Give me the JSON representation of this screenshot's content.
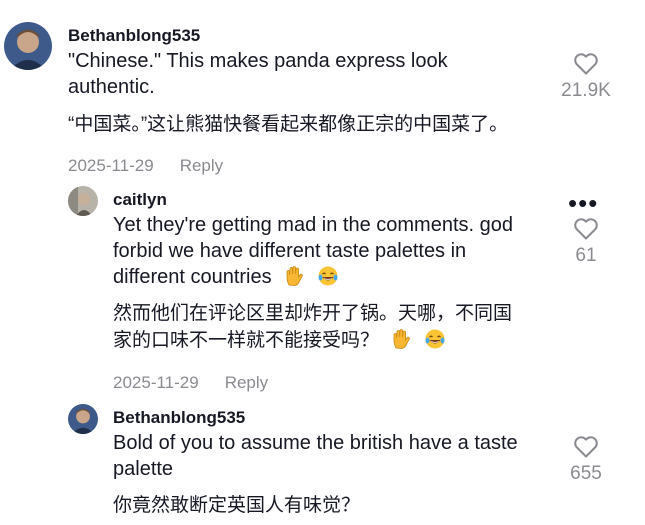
{
  "comments": [
    {
      "username": "Bethanblong535",
      "text_line1": "\"Chinese.\" This makes panda express look",
      "text_line2": "authentic.",
      "translation": "“中国菜。”这让熊猫快餐看起来都像正宗的中国菜了。",
      "date": "2025-11-29",
      "reply_label": "Reply",
      "likes": "21.9K"
    },
    {
      "username": "caitlyn",
      "text_line1": "Yet they're getting mad in the comments. god",
      "text_line2": "forbid we have different taste palettes in",
      "text_line3": "different countries",
      "translation_line1": "然而他们在评论区里却炸开了锅。天哪，不同国",
      "translation_line2": "家的口味不一样就不能接受吗？",
      "date": "2025-11-29",
      "reply_label": "Reply",
      "likes": "61",
      "more_icon": "•••"
    },
    {
      "username": "Bethanblong535",
      "text_line1": "Bold of you to assume the british have a taste",
      "text_line2": "palette",
      "translation": "你竟然敢断定英国人有味觉？",
      "likes": "655"
    }
  ],
  "icons": {
    "like": "heart-outline-icon",
    "emoji_hand": "raised-hand-emoji",
    "emoji_laugh": "tears-of-joy-emoji"
  }
}
